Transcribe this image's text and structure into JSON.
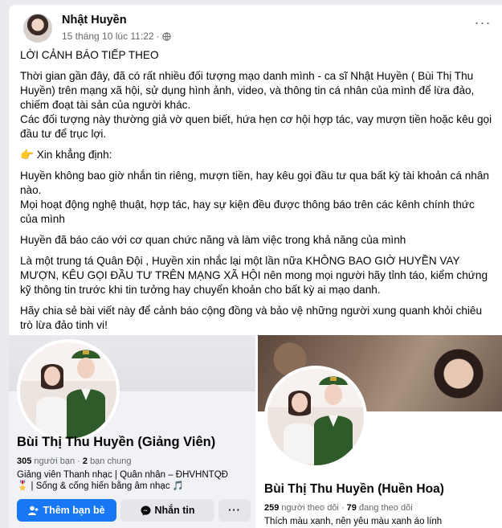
{
  "post": {
    "author": "Nhật Huyền",
    "timestamp": "15 tháng 10 lúc 11:22",
    "separator": "·",
    "more_label": "···",
    "paragraphs": [
      "LỜI CẢNH BÁO TIẾP THEO",
      "Thời gian gần đây, đã có rất nhiều đối tượng mạo danh mình - ca sĩ Nhật Huyền ( Bùi Thị Thu Huyền) trên mạng xã hội, sử dụng hình ảnh, video, và thông tin cá nhân của mình để lừa đảo, chiếm đoạt tài sản của người khác.",
      "Các đối tượng này thường giả vờ quen biết, hứa hẹn cơ hội hợp tác, vay mượn tiền hoặc kêu gọi đầu tư để trục lợi.",
      "👉 Xin khẳng định:",
      " Huyền không bao giờ nhắn tin riêng, mượn tiền, hay kêu gọi đầu tư qua bất kỳ tài khoản cá nhân nào.",
      "Mọi hoạt động nghệ thuật, hợp tác, hay sự kiện đều được thông báo trên các kênh chính thức của mình",
      "Huyền đã báo cáo với cơ quan chức năng và làm việc trong khả năng của mình",
      "Là một trung tá Quân Đội , Huyền xin nhắc lại một lần nữa KHÔNG BAO GIỜ HUYỀN VAY MƯỢN, KÊU GỌI ĐẦU TƯ TRÊN MẠNG XÃ HỘI nên mong mọi người hãy tỉnh táo, kiểm chứng kỹ thông tin trước khi tin tưởng hay chuyển khoản cho bất kỳ ai mạo danh.",
      "Hãy chia sẻ bài viết này để cảnh báo cộng đồng và bảo vệ những người xung quanh khỏi chiêu trò lừa đảo tinh vi!"
    ]
  },
  "profile_left": {
    "name": "Bùi Thị Thu Huyền (Giảng Viên)",
    "followers_count": "305",
    "followers_label": "người bạn",
    "mutual_count": "2",
    "mutual_label": "bạn chung",
    "bio_line1": "Giảng viên Thanh nhạc | Quân nhân – ĐHVHNTQĐ",
    "bio_line2": "🎖️ | Sống & cống hiến bằng âm nhạc 🎵",
    "add_friend_label": "Thêm bạn bè",
    "message_label": "Nhắn tin",
    "more_label": "···"
  },
  "profile_right": {
    "name": "Bùi Thị Thu Huyền (Huền Hoa)",
    "followers_count": "259",
    "followers_label": "người theo dõi",
    "following_count": "79",
    "following_label": "đang theo dõi",
    "bio": "Thích màu xanh, nên yêu màu xanh áo lính"
  },
  "colors": {
    "accent": "#1877f2",
    "muted_text": "#65676b",
    "button_gray": "#e4e6eb",
    "uniform_green": "#2f5a2a"
  }
}
